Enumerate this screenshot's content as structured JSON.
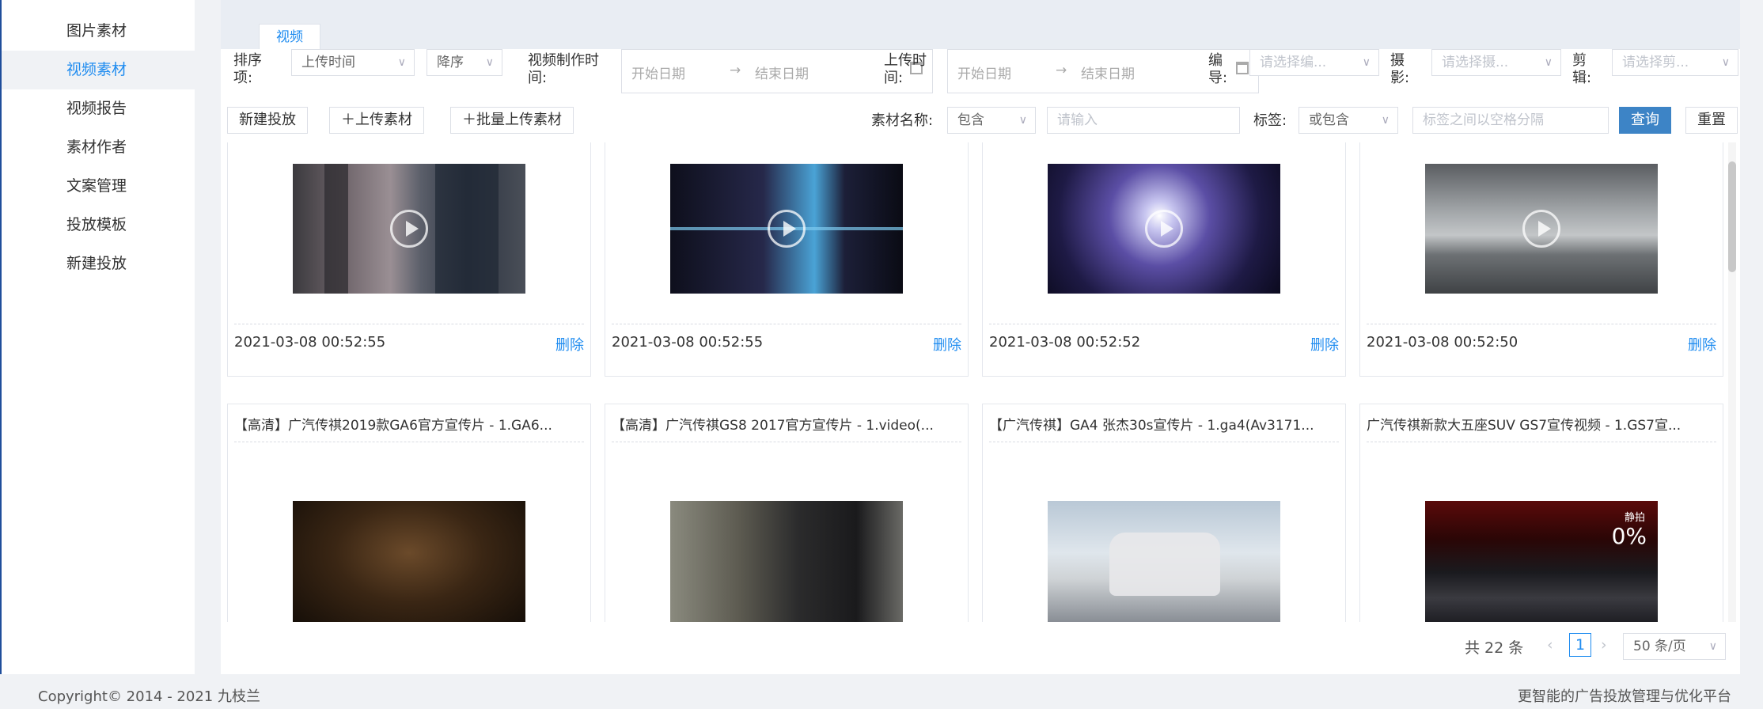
{
  "sidebar": {
    "items": [
      {
        "label": "图片素材"
      },
      {
        "label": "视频素材"
      },
      {
        "label": "视频报告"
      },
      {
        "label": "素材作者"
      },
      {
        "label": "文案管理"
      },
      {
        "label": "投放模板"
      },
      {
        "label": "新建投放"
      }
    ],
    "active_index": 1
  },
  "tabs": [
    {
      "label": "视频"
    }
  ],
  "filters": {
    "sort_label": "排序项:",
    "sort_field_value": "上传时间",
    "sort_order_value": "降序",
    "make_time_label": "视频制作时间:",
    "make_start_placeholder": "开始日期",
    "make_end_placeholder": "结束日期",
    "upload_time_label": "上传时间:",
    "upload_start_placeholder": "开始日期",
    "upload_end_placeholder": "结束日期",
    "director_label": "编导:",
    "director_placeholder": "请选择编...",
    "camera_label": "摄影:",
    "camera_placeholder": "请选择摄...",
    "editor_label": "剪辑:",
    "editor_placeholder": "请选择剪...",
    "range_arrow": "→"
  },
  "toolbar": {
    "new_campaign": "新建投放",
    "upload": "上传素材",
    "batch_upload": "批量上传素材",
    "name_label": "素材名称:",
    "name_match_value": "包含",
    "name_placeholder": "请输入",
    "tag_label": "标签:",
    "tag_match_value": "或包含",
    "tag_placeholder": "标签之间以空格分隔",
    "query": "查询",
    "reset": "重置"
  },
  "cards_row1": [
    {
      "date": "2021-03-08 00:52:55",
      "delete": "删除",
      "thumb": "city-towers"
    },
    {
      "date": "2021-03-08 00:52:55",
      "delete": "删除",
      "thumb": "dark-corridor"
    },
    {
      "date": "2021-03-08 00:52:52",
      "delete": "删除",
      "thumb": "car-light"
    },
    {
      "date": "2021-03-08 00:52:50",
      "delete": "删除",
      "thumb": "cloud-mountains"
    }
  ],
  "cards_row2": [
    {
      "title": "【高清】广汽传祺2019款GA6官方宣传片 - 1.GA6...",
      "thumb": "orchestra"
    },
    {
      "title": "【高清】广汽传祺GS8 2017官方宣传片 - 1.video(...",
      "thumb": "forest-suv"
    },
    {
      "title": "【广汽传祺】GA4 张杰30s宣传片 - 1.ga4(Av3171...",
      "thumb": "silver-sedan"
    },
    {
      "title": "广汽传祺新款大五座SUV GS7宣传视频 - 1.GS7宣...",
      "thumb": "grille-closeup",
      "overlay_label": "静拍",
      "overlay_value": "0%"
    }
  ],
  "pagination": {
    "total": "共 22 条",
    "current_page": "1",
    "page_size": "50 条/页"
  },
  "footer": {
    "copyright": "Copyright© 2014 - 2021 九枝兰",
    "slogan": "更智能的广告投放管理与优化平台"
  },
  "colors": {
    "accent": "#1f8cf0",
    "primary_button": "#3d84c6",
    "sidebar_border": "#1f4e9b"
  }
}
